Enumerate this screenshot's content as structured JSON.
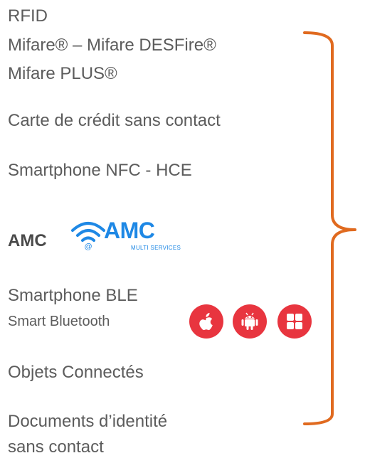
{
  "lines": {
    "rfid": "RFID",
    "mifare1": "Mifare® – Mifare DESFire®",
    "mifare2": "Mifare PLUS®",
    "credit_card": "Carte de crédit sans contact",
    "nfc": "Smartphone NFC - HCE",
    "amc_label": "AMC",
    "ble": "Smartphone BLE",
    "bluetooth": "Smart Bluetooth",
    "objects": "Objets Connectés",
    "id_docs_1": "Documents d’identité",
    "id_docs_2": "sans contact"
  },
  "amc_logo": {
    "brand": "AMC",
    "sub": "MULTI SERVICES",
    "icon": "wifi-at-icon"
  },
  "os_badges": [
    {
      "icon": "apple-icon"
    },
    {
      "icon": "android-icon"
    },
    {
      "icon": "windows-icon"
    }
  ],
  "colors": {
    "text": "#5c5c5c",
    "brace": "#e06a1f",
    "badge": "#e8353f",
    "amc_blue": "#1e88e5"
  }
}
